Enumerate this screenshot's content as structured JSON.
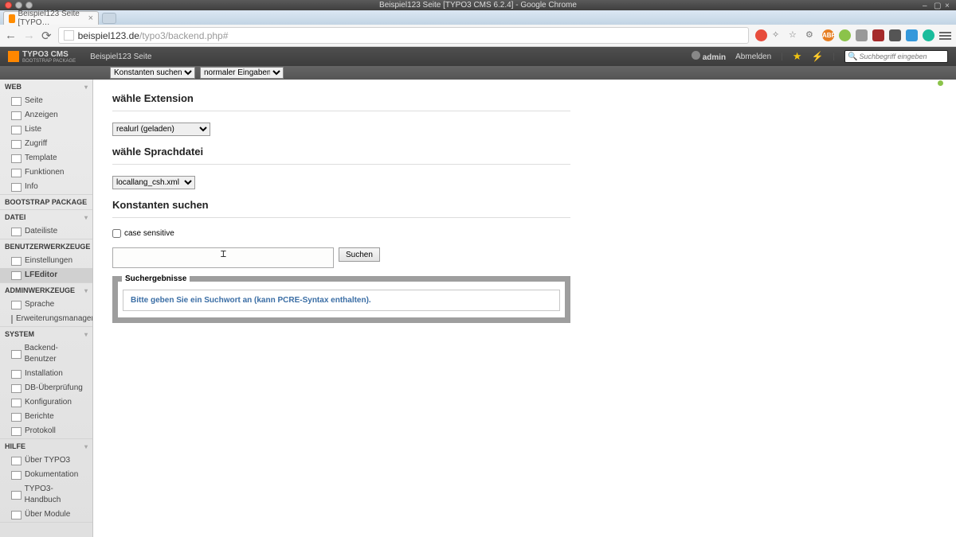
{
  "os": {
    "title": "Beispiel123 Seite [TYPO3 CMS 6.2.4] - Google Chrome"
  },
  "browser": {
    "tab_title": "Beispiel123 Seite [TYPO…",
    "url_host": "beispiel123.de",
    "url_path": "/typo3/backend.php#"
  },
  "topbar": {
    "product": "TYPO3 CMS",
    "tagline": "BOOTSTRAP PACKAGE",
    "site": "Beispiel123 Seite",
    "user": "admin",
    "logout": "Abmelden",
    "search_placeholder": "Suchbegriff eingeben"
  },
  "docheader": {
    "select1": "Konstanten suchen",
    "select2": "normaler Eingabemodus"
  },
  "sidebar": {
    "web": {
      "title": "Web",
      "items": [
        "Seite",
        "Anzeigen",
        "Liste",
        "Zugriff",
        "Template",
        "Funktionen",
        "Info"
      ]
    },
    "bootstrap": {
      "title": "Bootstrap Package"
    },
    "datei": {
      "title": "Datei",
      "items": [
        "Dateiliste"
      ]
    },
    "benutzer": {
      "title": "Benutzerwerkzeuge",
      "items": [
        "Einstellungen",
        "LFEditor"
      ]
    },
    "admin": {
      "title": "Adminwerkzeuge",
      "items": [
        "Sprache",
        "Erweiterungsmanager"
      ]
    },
    "system": {
      "title": "System",
      "items": [
        "Backend-Benutzer",
        "Installation",
        "DB-Überprüfung",
        "Konfiguration",
        "Berichte",
        "Protokoll"
      ]
    },
    "hilfe": {
      "title": "Hilfe",
      "items": [
        "Über TYPO3",
        "Dokumentation",
        "TYPO3-Handbuch",
        "Über Module"
      ]
    }
  },
  "content": {
    "h_ext": "wähle Extension",
    "ext_value": "realurl (geladen)",
    "h_lang": "wähle Sprachdatei",
    "lang_value": "locallang_csh.xml",
    "h_search": "Konstanten suchen",
    "case_label": "case sensitive",
    "search_value": "",
    "btn_search": "Suchen",
    "results_legend": "Suchergebnisse",
    "results_msg": "Bitte geben Sie ein Suchwort an (kann PCRE-Syntax enthalten)."
  }
}
